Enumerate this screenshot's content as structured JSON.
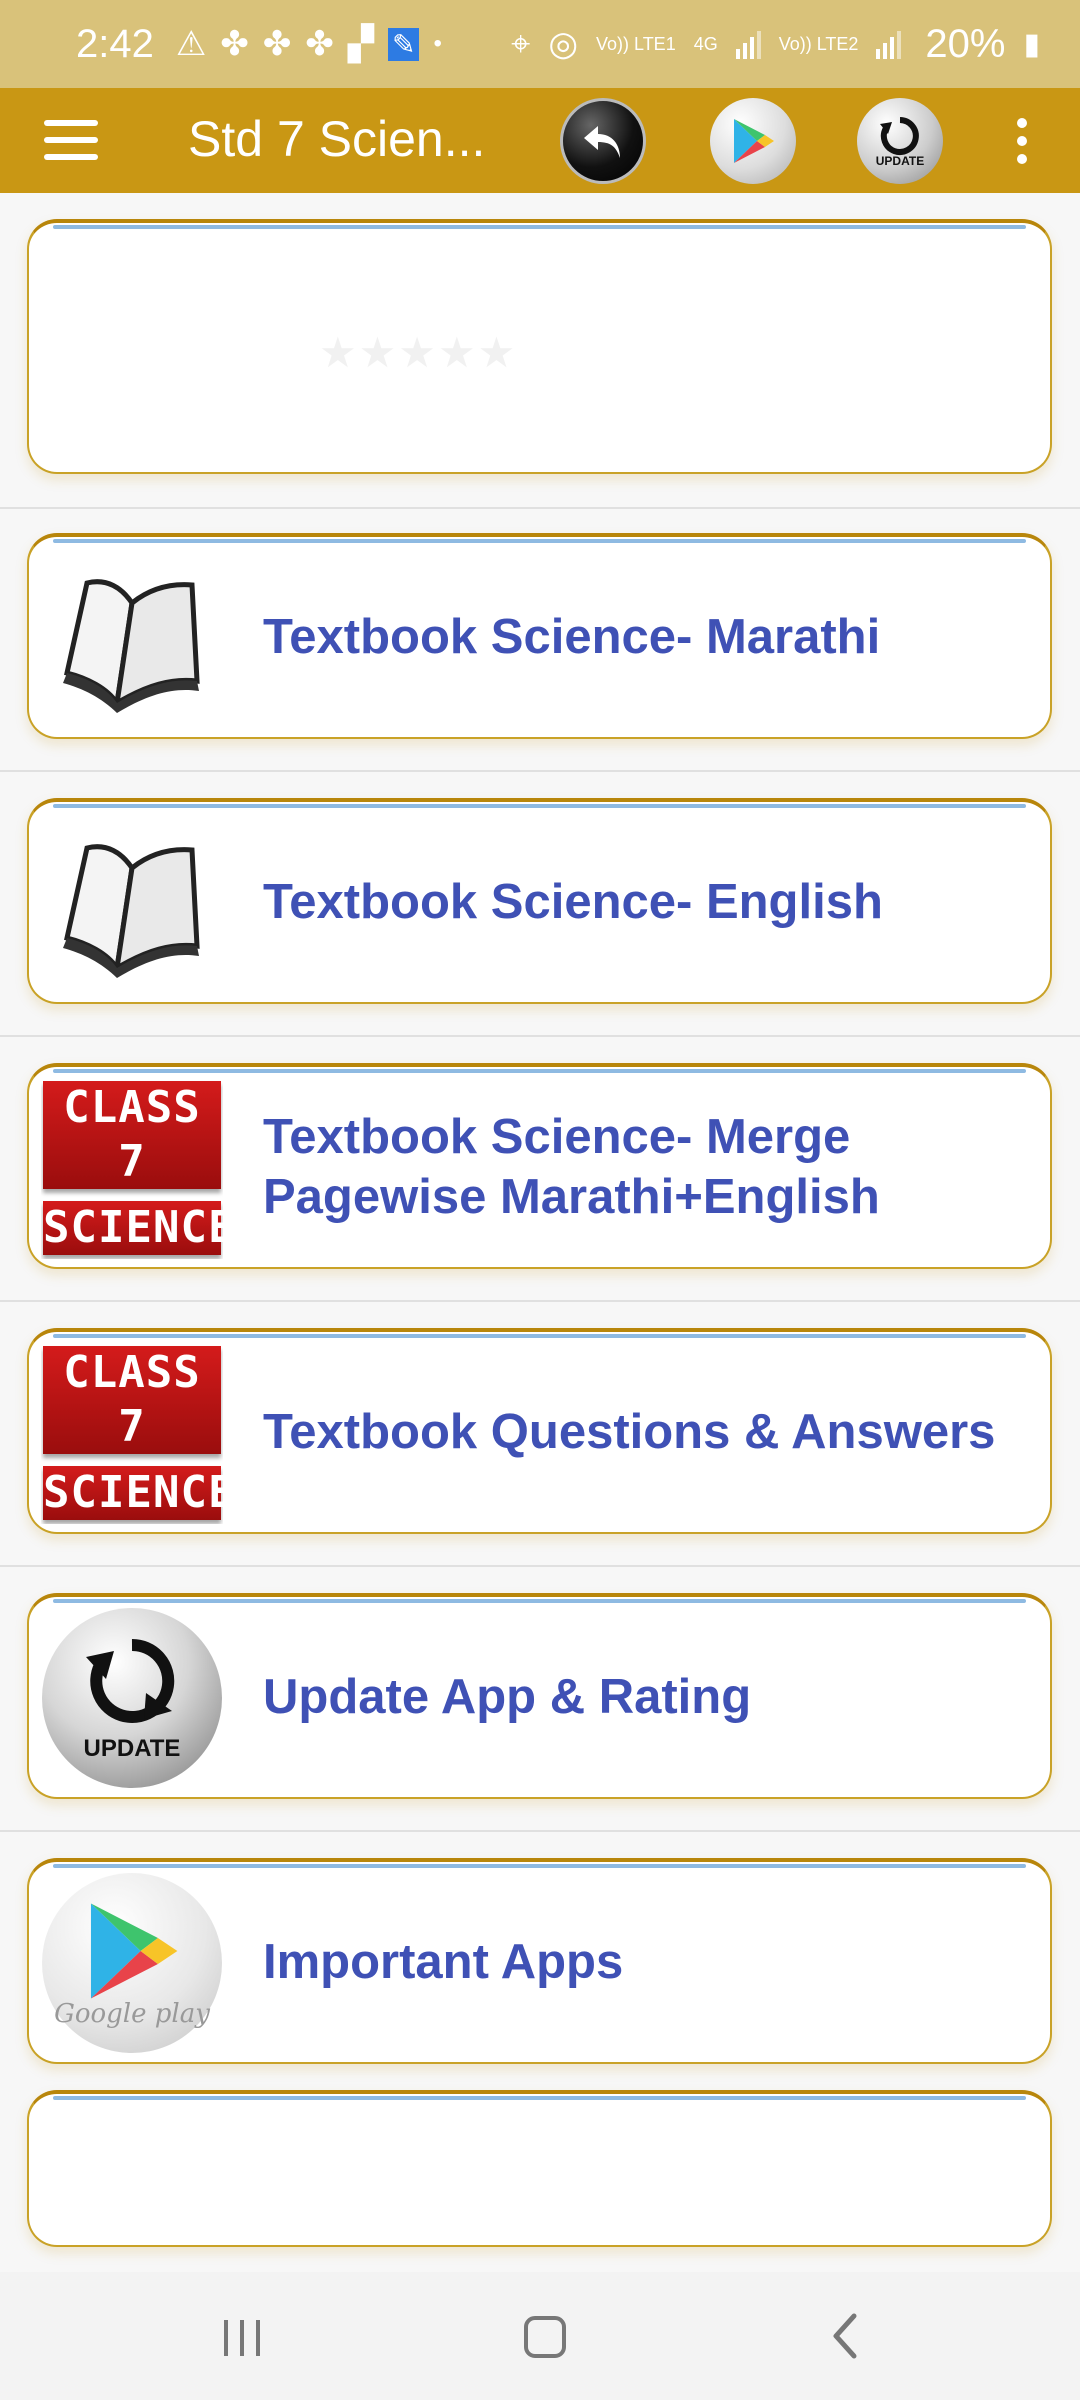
{
  "status_bar": {
    "time": "2:42",
    "battery": "20%",
    "net1": "Vo)) LTE1",
    "net2": "4G",
    "net3": "Vo)) LTE2"
  },
  "app_bar": {
    "title": "Std 7 Scien...",
    "update_label": "UPDATE",
    "accent": "#c99714"
  },
  "menu_items": [
    {
      "label": "Textbook Science- Marathi",
      "icon": "open-book-icon"
    },
    {
      "label": "Textbook Science- English",
      "icon": "open-book-icon"
    },
    {
      "label": "Textbook Science- Merge Pagewise Marathi+English",
      "icon": "class7-science-icon"
    },
    {
      "label": "Textbook Questions & Answers",
      "icon": "class7-science-icon"
    },
    {
      "label": "Update App & Rating",
      "icon": "update-logo-icon"
    },
    {
      "label": "Important Apps",
      "icon": "google-play-icon"
    }
  ],
  "thumbs": {
    "class7_line1": "CLASS 7",
    "class7_line2": "SCIENCE",
    "update_text": "UPDATE",
    "google_play_text": "Google play"
  },
  "colors": {
    "status_bar": "#d9c27a",
    "label_text": "#3f51b5",
    "card_border": "#c9a227"
  }
}
